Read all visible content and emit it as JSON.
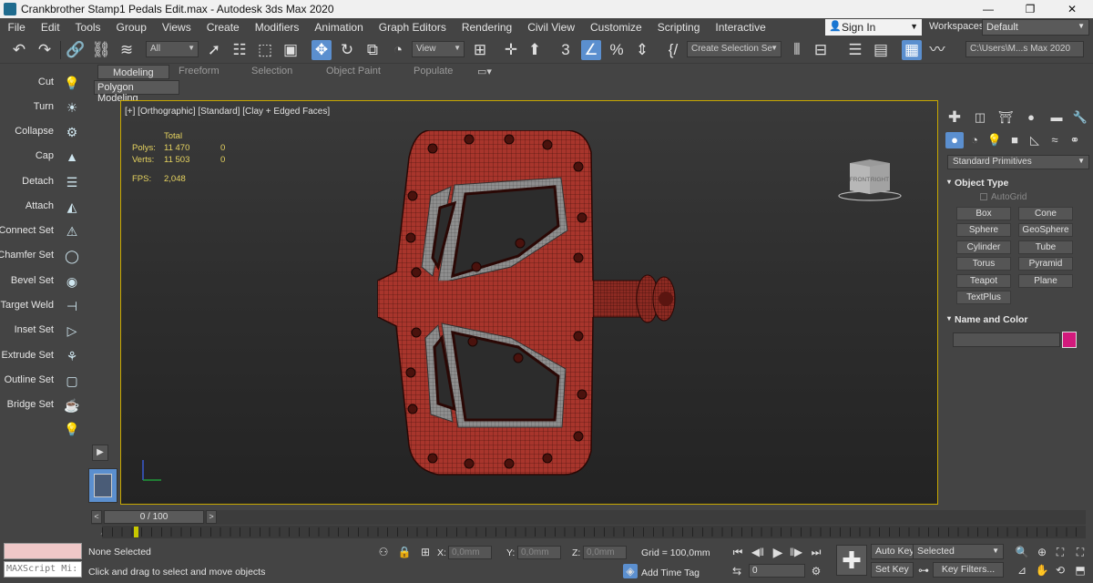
{
  "window": {
    "title": "Crankbrother Stamp1 Pedals Edit.max - Autodesk 3ds Max 2020",
    "min": "—",
    "max": "❐",
    "close": "✕"
  },
  "menu": [
    "File",
    "Edit",
    "Tools",
    "Group",
    "Views",
    "Create",
    "Modifiers",
    "Animation",
    "Graph Editors",
    "Rendering",
    "Civil View",
    "Customize",
    "Scripting",
    "Interactive"
  ],
  "signin": {
    "label": "Sign In"
  },
  "workspaces": {
    "label": "Workspaces:",
    "value": "Default"
  },
  "toolbar": {
    "filter_dropdown": "All",
    "view_dropdown": "View",
    "selection_set": "Create Selection Se",
    "path": "C:\\Users\\M...s Max 2020"
  },
  "ribbon": {
    "tabs": [
      "Modeling",
      "Freeform",
      "Selection",
      "Object Paint",
      "Populate"
    ],
    "active_tab": "Modeling",
    "panel_label": "Polygon Modeling"
  },
  "left_tools": [
    {
      "label": "Cut",
      "icon": "cut-icon",
      "glyph": "💡"
    },
    {
      "label": "Turn",
      "icon": "turn-icon",
      "glyph": "☀"
    },
    {
      "label": "Collapse",
      "icon": "collapse-icon",
      "glyph": "⚙"
    },
    {
      "label": "Cap",
      "icon": "cap-icon",
      "glyph": "▲"
    },
    {
      "label": "Detach",
      "icon": "detach-icon",
      "glyph": "☰"
    },
    {
      "label": "Attach",
      "icon": "attach-icon",
      "glyph": "◭"
    },
    {
      "label": "Connect Set",
      "icon": "connect-set-icon",
      "glyph": "⚠"
    },
    {
      "label": "Chamfer Set",
      "icon": "chamfer-set-icon",
      "glyph": "◯"
    },
    {
      "label": "Bevel Set",
      "icon": "bevel-set-icon",
      "glyph": "◉"
    },
    {
      "label": "Target Weld",
      "icon": "target-weld-icon",
      "glyph": "⊣"
    },
    {
      "label": "Inset Set",
      "icon": "inset-set-icon",
      "glyph": "▷"
    },
    {
      "label": "Extrude Set",
      "icon": "extrude-set-icon",
      "glyph": "⚘"
    },
    {
      "label": "Outline Set",
      "icon": "outline-set-icon",
      "glyph": "▢"
    },
    {
      "label": "Bridge Set",
      "icon": "bridge-set-icon",
      "glyph": "☕"
    },
    {
      "label": "",
      "icon": "light-bulb-icon",
      "glyph": "💡"
    }
  ],
  "viewport": {
    "label": "[+] [Orthographic] [Standard] [Clay + Edged Faces]",
    "stats": {
      "header": "Total",
      "polys_label": "Polys:",
      "polys_total": "11 470",
      "polys_sel": "0",
      "verts_label": "Verts:",
      "verts_total": "11 503",
      "verts_sel": "0",
      "fps_label": "FPS:",
      "fps": "2,048"
    },
    "viewcube": {
      "front": "FRONT",
      "right": "RIGHT"
    }
  },
  "right_panel": {
    "category": "Standard Primitives",
    "object_type_title": "Object Type",
    "autogrid": "AutoGrid",
    "primitives": [
      "Box",
      "Cone",
      "Sphere",
      "GeoSphere",
      "Cylinder",
      "Tube",
      "Torus",
      "Pyramid",
      "Teapot",
      "Plane",
      "TextPlus"
    ],
    "name_color_title": "Name and Color",
    "object_color": "#d21a7c"
  },
  "timeline": {
    "frame": "0 / 100",
    "prev": "<",
    "next": ">",
    "start_label": "0"
  },
  "status": {
    "selection": "None Selected",
    "prompt": "Click and drag to select and move objects",
    "maxscript": "MAXScript Mi:",
    "x_label": "X:",
    "x_value": "0,0mm",
    "y_label": "Y:",
    "y_value": "0,0mm",
    "z_label": "Z:",
    "z_value": "0,0mm",
    "grid": "Grid = 100,0mm",
    "add_time_tag": "Add Time Tag",
    "auto_key": "Auto Key",
    "set_key": "Set Key",
    "key_mode": "Selected",
    "key_filters": "Key Filters...",
    "frame_field": "0"
  },
  "colors": {
    "accent": "#5b8fcf",
    "viewport_border": "#c8a800",
    "stats_text": "#e7d460",
    "mesh": "#a8352c"
  }
}
